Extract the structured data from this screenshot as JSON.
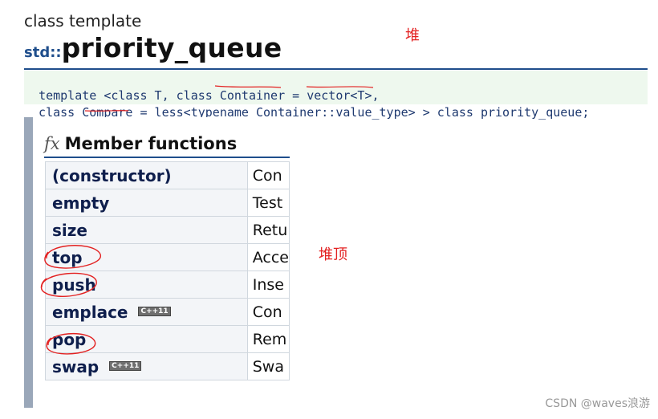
{
  "header": {
    "class_template": "class template",
    "namespace": "std::",
    "name": "priority_queue"
  },
  "annotations": {
    "heap": "堆",
    "heap_top": "堆顶"
  },
  "code": {
    "line1": "template <class T, class Container = vector<T>,",
    "line2": "  class Compare = less<typename Container::value_type> > class priority_queue;"
  },
  "section": {
    "icon": "fx",
    "title": "Member functions"
  },
  "members": [
    {
      "name": "(constructor)",
      "desc": "Con",
      "badge": ""
    },
    {
      "name": "empty",
      "desc": "Test",
      "badge": ""
    },
    {
      "name": "size",
      "desc": "Retu",
      "badge": ""
    },
    {
      "name": "top",
      "desc": "Acce",
      "badge": ""
    },
    {
      "name": "push",
      "desc": "Inse",
      "badge": ""
    },
    {
      "name": "emplace",
      "desc": "Con",
      "badge": "C++11"
    },
    {
      "name": "pop",
      "desc": "Rem",
      "badge": ""
    },
    {
      "name": "swap",
      "desc": "Swa",
      "badge": "C++11"
    }
  ],
  "watermark": "CSDN @waves浪游",
  "colors": {
    "annotation_red": "#e32121",
    "code_bg": "#eef8ee",
    "rule_blue": "#1f4e8c"
  }
}
